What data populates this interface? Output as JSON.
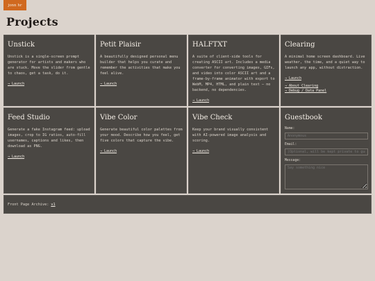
{
  "brand": {
    "label": "jonn hr"
  },
  "page": {
    "title": "Projects"
  },
  "cards": [
    {
      "title": "Unstick",
      "desc": "Unstick is a single-screen prompt generator for artists and makers who are stuck. Move the slider from gentle to chaos, get a task, do it.",
      "links": [
        "→ Launch"
      ]
    },
    {
      "title": "Petit Plaisir",
      "desc": "A beautifully designed personal menu builder that helps you curate and remember the activities that make you feel alive.",
      "links": [
        "→ Launch"
      ]
    },
    {
      "title": "HALFTXT",
      "desc": "A suite of client-side tools for creating ASCII art. Includes a media converter for converting images, GIFs, and video into color ASCII art and a frame-by-frame animator with export to WebM, MP4, HTML, and plain text — no backend, no dependencies.",
      "links": [
        "→ Launch"
      ]
    },
    {
      "title": "Clearing",
      "desc": "A minimal home screen dashboard. Live weather, the time, and a quiet way to launch any app, without distraction.",
      "links": [
        "→ Launch",
        "→ About Clearing",
        "→ Debug / Data Panel"
      ]
    },
    {
      "title": "Feed Studio",
      "desc": "Generate a fake Instagram feed: upload images, crop to IG ratios, auto-fill usernames, captions and likes, then download as PNG.",
      "links": [
        "→ Launch"
      ]
    },
    {
      "title": "Vibe Color",
      "desc": "Generate beautiful color palettes from your mood. Describe how you feel, get five colors that capture the vibe.",
      "links": [
        "→ Launch"
      ]
    },
    {
      "title": "Vibe Check",
      "desc": "Keep your brand visually consistent with AI-powered image analysis and scoring.",
      "links": [
        "→ Launch"
      ]
    }
  ],
  "guestbook": {
    "title": "Guestbook",
    "name_label": "Name:",
    "name_placeholder": "Anonymous",
    "email_label": "Email:",
    "email_placeholder": "(Optional, will be kept private to guests)",
    "message_label": "Message:",
    "message_placeholder": "Say something nice"
  },
  "footer": {
    "text": "Front Page Archive:",
    "link": "v1"
  }
}
